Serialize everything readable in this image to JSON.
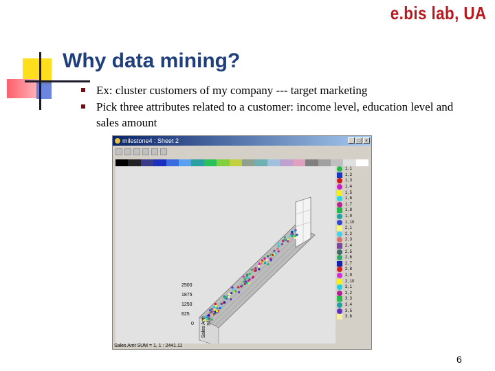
{
  "brand": "e.bis lab, UA",
  "slide_title": "Why data mining?",
  "bullets": [
    "Ex: cluster customers of my company --- target marketing",
    "Pick three attributes related to a customer: income level, education level and sales amount"
  ],
  "window": {
    "title": "milestone4 : Sheet 2",
    "min_btn": "_",
    "max_btn": "□",
    "close_btn": "×"
  },
  "chart_data": {
    "type": "scatter",
    "y_ticks": [
      "2500",
      "1875",
      "1250",
      "625",
      "0"
    ],
    "axis_label_a": "Sales Amt",
    "axis_label_b": "SUM"
  },
  "legend": [
    {
      "label": "1, 1",
      "color": "#27b84b"
    },
    {
      "label": "1, 2",
      "color": "#1537c4"
    },
    {
      "label": "1, 3",
      "color": "#cc1c1c"
    },
    {
      "label": "1, 4",
      "color": "#c81fc8"
    },
    {
      "label": "1, 5",
      "color": "#f3f020"
    },
    {
      "label": "1, 6",
      "color": "#24d7e0"
    },
    {
      "label": "1, 7",
      "color": "#b8258e"
    },
    {
      "label": "1, 8",
      "color": "#27b84b"
    },
    {
      "label": "1, 9",
      "color": "#1fa3a3"
    },
    {
      "label": "1, 10",
      "color": "#3048d0"
    },
    {
      "label": "2, 1",
      "color": "#f5f580"
    },
    {
      "label": "2, 2",
      "color": "#42d2e8"
    },
    {
      "label": "2, 3",
      "color": "#d87070"
    },
    {
      "label": "2, 4",
      "color": "#7a4a9a"
    },
    {
      "label": "2, 5",
      "color": "#3f6a6a"
    },
    {
      "label": "2, 6",
      "color": "#2ea86a"
    },
    {
      "label": "2, 7",
      "color": "#1420b0"
    },
    {
      "label": "2, 8",
      "color": "#d02020"
    },
    {
      "label": "2, 9",
      "color": "#d030d0"
    },
    {
      "label": "2, 10",
      "color": "#f5f020"
    },
    {
      "label": "3, 1",
      "color": "#20d0e0"
    },
    {
      "label": "3, 2",
      "color": "#b02090"
    },
    {
      "label": "3, 3",
      "color": "#2ab850"
    },
    {
      "label": "3, 4",
      "color": "#20a0a0"
    },
    {
      "label": "3, 5",
      "color": "#6030c0"
    },
    {
      "label": "3, 6",
      "color": "#f8f0a0"
    }
  ],
  "status_text": "Sales Amt SUM = 1, 1 : 2441.11",
  "page_number": "6"
}
